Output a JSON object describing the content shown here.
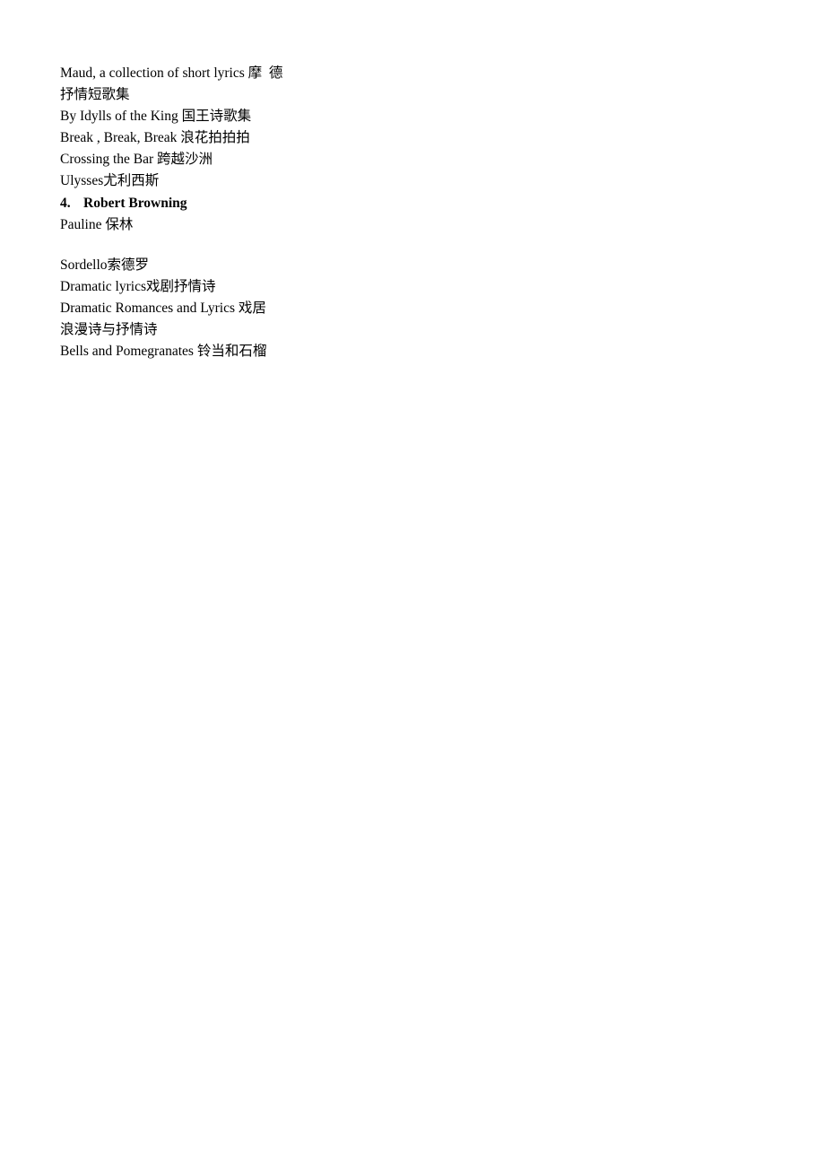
{
  "document": {
    "background_color": "#ffffff",
    "text_color": "#000000",
    "lines": [
      {
        "id": "maud",
        "text": "Maud, a collection of short lyrics 摩  德"
      },
      {
        "id": "maud-cont",
        "text": "抒情短歌集"
      },
      {
        "id": "idylls",
        "text": "By Idylls of the King 国王诗歌集"
      },
      {
        "id": "break",
        "text": "Break , Break, Break 浪花拍拍拍"
      },
      {
        "id": "crossing-the-bar",
        "text": "Crossing the Bar 跨越沙洲"
      },
      {
        "id": "ulysses",
        "text": "Ulysses尤利西斯"
      },
      {
        "id": "robert-browning-heading",
        "number": "4.",
        "text": "Robert Browning"
      },
      {
        "id": "pauline",
        "text": "Pauline 保林"
      },
      {
        "id": "sordello",
        "text": "Sordello索德罗"
      },
      {
        "id": "dramatic-lyrics",
        "text": "Dramatic lyrics戏剧抒情诗"
      },
      {
        "id": "dramatic-romances",
        "text": "Dramatic Romances and Lyrics 戏居"
      },
      {
        "id": "dramatic-romances-cont",
        "text": "浪漫诗与抒情诗"
      },
      {
        "id": "bells-and-pomegranates",
        "text": "Bells and Pomegranates 铃当和石榴"
      }
    ]
  }
}
